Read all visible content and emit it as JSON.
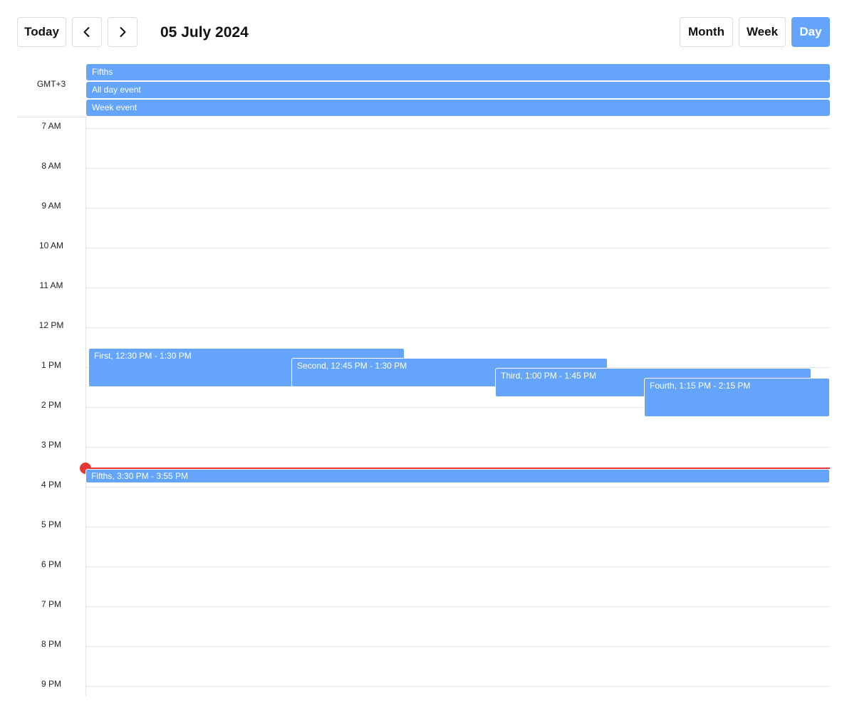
{
  "toolbar": {
    "today_label": "Today",
    "prev_icon": "chevron-left-icon",
    "next_icon": "chevron-right-icon",
    "date_title": "05 July 2024",
    "views": {
      "month": "Month",
      "week": "Week",
      "day": "Day"
    },
    "active_view": "Day",
    "accent_color": "#64a5fb"
  },
  "timezone": "GMT+3",
  "all_day_events": [
    {
      "title": "Fifths"
    },
    {
      "title": "All day event"
    },
    {
      "title": "Week event"
    }
  ],
  "hours": [
    "7 AM",
    "8 AM",
    "9 AM",
    "10 AM",
    "11 AM",
    "12 PM",
    "1 PM",
    "2 PM",
    "3 PM",
    "4 PM",
    "5 PM",
    "6 PM",
    "7 PM",
    "8 PM",
    "9 PM"
  ],
  "events": [
    {
      "label": "First, 12:30 PM - 1:30 PM"
    },
    {
      "label": "Second, 12:45 PM - 1:30 PM"
    },
    {
      "label": "Third, 1:00 PM - 1:45 PM"
    },
    {
      "label": "Fourth, 1:15 PM - 2:15 PM"
    },
    {
      "label": "Fifths, 3:30 PM - 3:55 PM"
    }
  ],
  "current_time_indicator_color": "#e53935"
}
